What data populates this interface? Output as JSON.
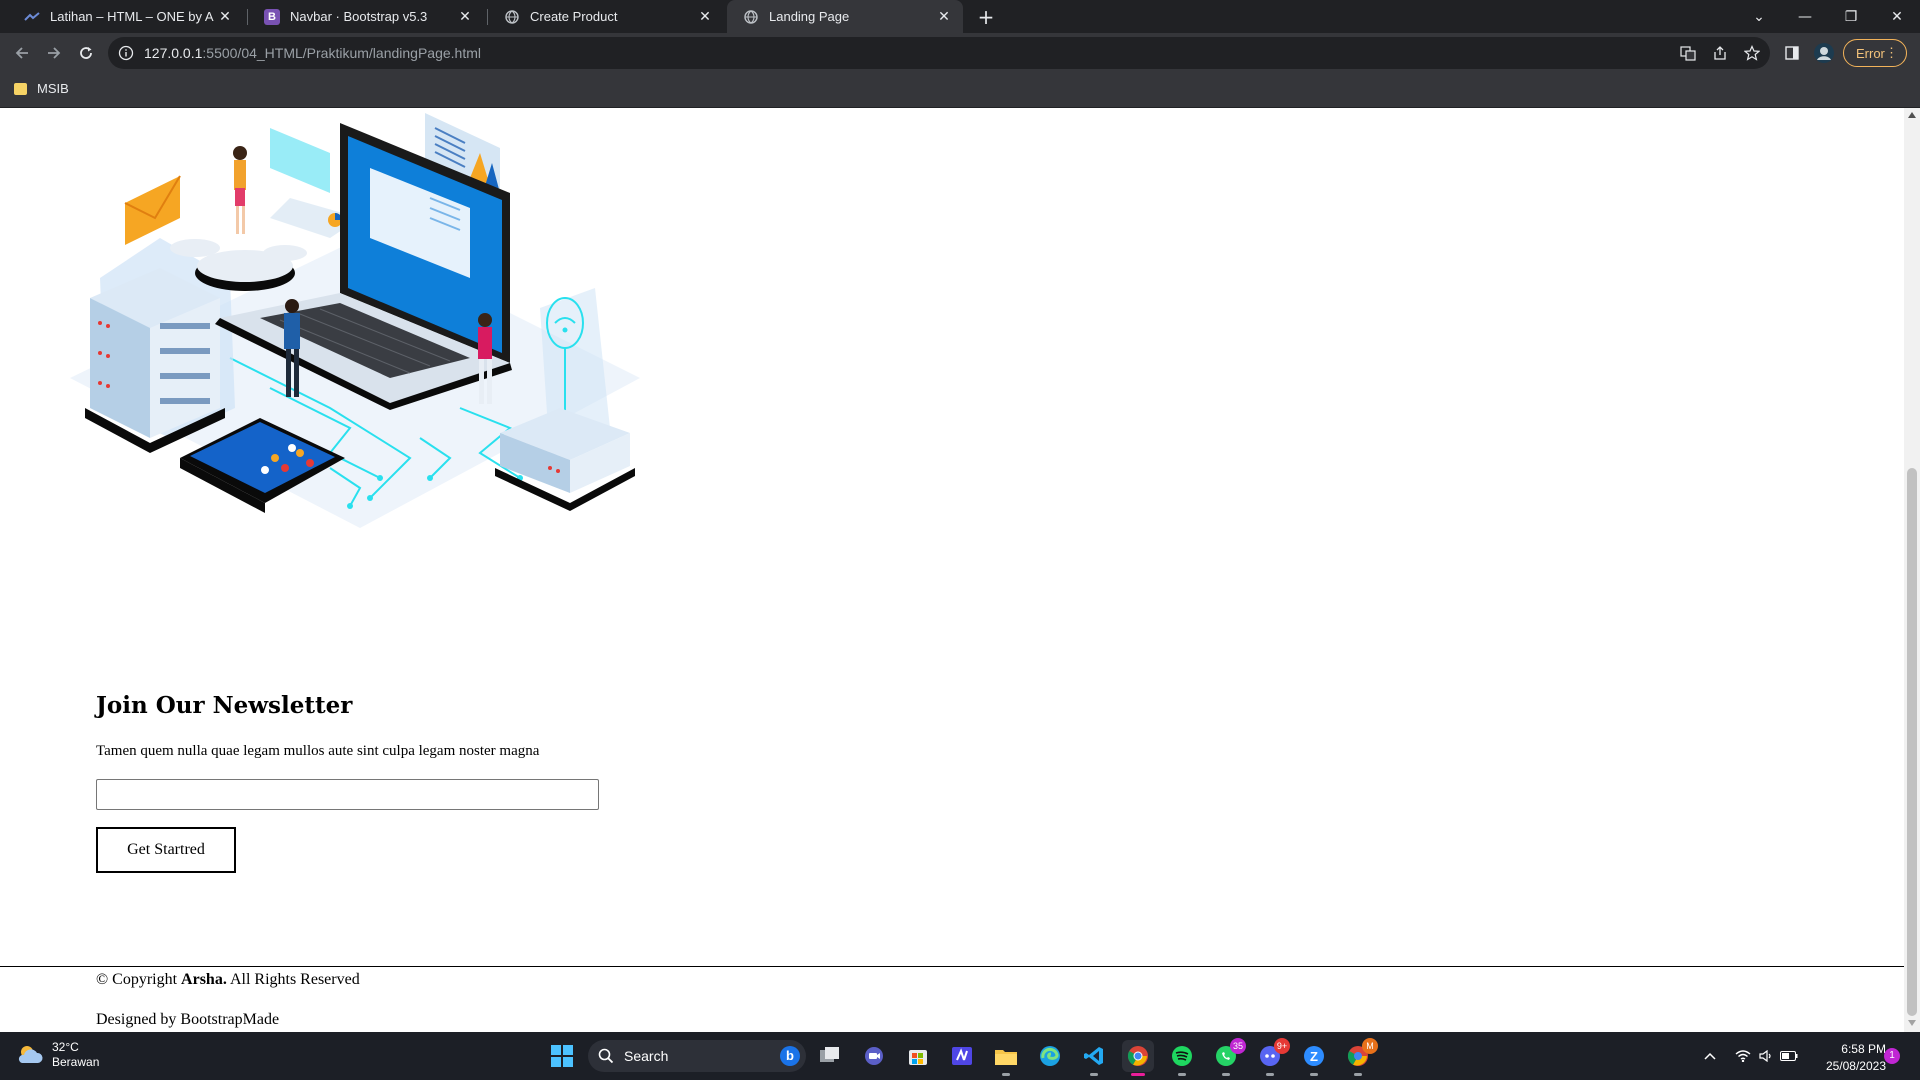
{
  "browser": {
    "tabs": [
      {
        "title": "Latihan – HTML – ONE by Alterra",
        "active": false
      },
      {
        "title": "Navbar · Bootstrap v5.3",
        "active": false,
        "favicon_letter": "B"
      },
      {
        "title": "Create Product",
        "active": false
      },
      {
        "title": "Landing Page",
        "active": true
      }
    ],
    "address": {
      "host": "127.0.0.1",
      "path": ":5500/04_HTML/Praktikum/landingPage.html"
    },
    "error_label": "Error",
    "bookmarks": [
      {
        "label": "MSIB"
      }
    ],
    "colors": {
      "tabstrip": "#202124",
      "toolbar": "#35363a",
      "bootstrap_purple": "#7952b3"
    }
  },
  "page": {
    "newsletter": {
      "title": "Join Our Newsletter",
      "description": "Tamen quem nulla quae legam mullos aute sint culpa legam noster magna",
      "input_value": "",
      "button_label": "Get Startred"
    },
    "footer": {
      "copyright_prefix": "© Copyright ",
      "brand": "Arsha.",
      "copyright_suffix": " All Rights Reserved",
      "designed_by": "Designed by BootstrapMade"
    }
  },
  "taskbar": {
    "weather": {
      "temp": "32°C",
      "condition": "Berawan"
    },
    "search_label": "Search",
    "badges": {
      "whatsapp": "35",
      "discord": "9+",
      "chrome_alt": "M"
    },
    "clock": {
      "time": "6:58 PM",
      "date": "25/08/2023"
    },
    "notifications": "1"
  }
}
